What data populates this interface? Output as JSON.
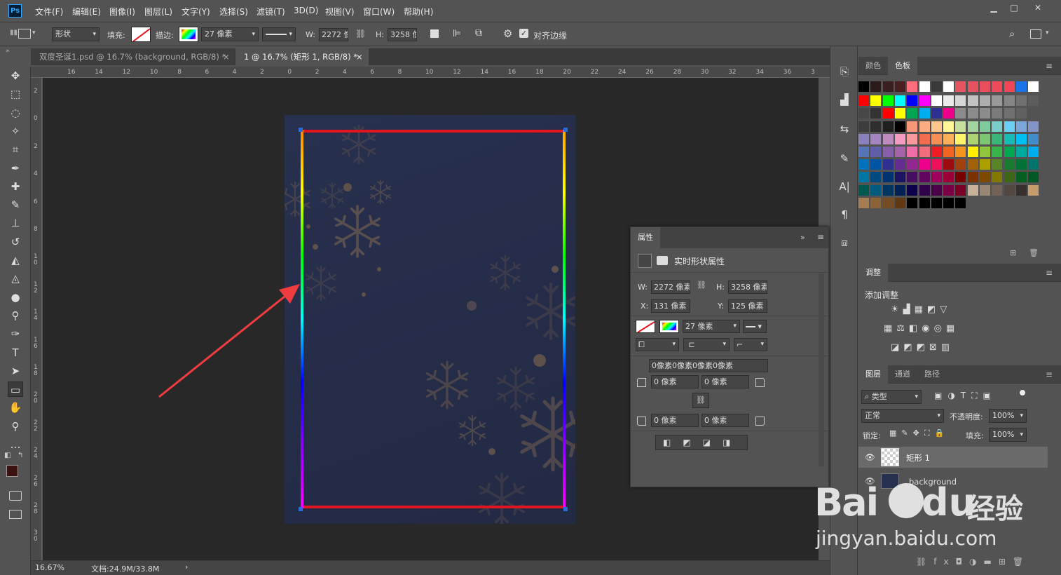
{
  "app": {
    "logo": "Ps"
  },
  "menu": [
    "文件(F)",
    "编辑(E)",
    "图像(I)",
    "图层(L)",
    "文字(Y)",
    "选择(S)",
    "滤镜(T)",
    "3D(D)",
    "视图(V)",
    "窗口(W)",
    "帮助(H)"
  ],
  "window_controls": {
    "minimize": "▁",
    "maximize": "□",
    "close": "✕"
  },
  "options": {
    "mode": "形状",
    "fill_label": "填充:",
    "stroke_label": "描边:",
    "stroke_width": "27 像素",
    "w_label": "W:",
    "w_value": "2272 像",
    "h_label": "H:",
    "h_value": "3258 像",
    "align_edges": "对齐边缘",
    "align_checked": true
  },
  "tabs": [
    {
      "label": "双度圣诞1.psd @ 16.7% (background, RGB/8) *",
      "close": "×",
      "active": false
    },
    {
      "label": "1 @ 16.7% (矩形 1, RGB/8) *",
      "close": "×",
      "active": true
    }
  ],
  "ruler_h": [
    "16",
    "14",
    "12",
    "10",
    "8",
    "6",
    "4",
    "2",
    "0",
    "2",
    "4",
    "6",
    "8",
    "10",
    "12",
    "14",
    "16",
    "18",
    "20",
    "22",
    "24",
    "26",
    "28",
    "30",
    "32",
    "34",
    "36",
    "3"
  ],
  "ruler_v": [
    "2",
    "0",
    "2",
    "4",
    "6",
    "8",
    "1\n0",
    "1\n2",
    "1\n4",
    "1\n6",
    "1\n8",
    "2\n0",
    "2\n2",
    "2\n4",
    "2\n6",
    "2\n8",
    "3\n0"
  ],
  "status": {
    "zoom": "16.67%",
    "doc": "文档:24.9M/33.8M",
    "arrow": "›"
  },
  "tools": [
    "move-icon",
    "marquee-icon",
    "lasso-icon",
    "magic-wand-icon",
    "crop-icon",
    "eyedropper-icon",
    "healing-icon",
    "brush-icon",
    "stamp-icon",
    "history-brush-icon",
    "eraser-icon",
    "bucket-icon",
    "blur-icon",
    "dodge-icon",
    "pen-icon",
    "type-icon",
    "path-select-icon",
    "rectangle-icon",
    "hand-icon",
    "zoom-icon",
    "more-icon"
  ],
  "colors": {
    "foreground": "#3a1212",
    "background": "#ffffff",
    "stroke_gradient": "rainbow",
    "frame": "#e2141e"
  },
  "swatches_panel": {
    "tab_color": "颜色",
    "tab_swatches": "色板"
  },
  "swatch_rows": [
    [
      "#000000",
      "#2b1a1a",
      "#3a1f1f",
      "#4a1f22",
      "#ff6e7a",
      "#ffffff",
      "#3a3a3a",
      "#ffffff",
      "#e65561",
      "#e8515f",
      "#ea4d5c",
      "#ee4a59",
      "#f04655",
      "#1a73e8",
      "#ffffff"
    ],
    [
      "#ff0000",
      "#ffff00",
      "#00ff00",
      "#00ffff",
      "#0000ff",
      "#ff00ff",
      "#ffffff",
      "#ebebeb",
      "#d6d6d6",
      "#c2c2c2",
      "#adadad",
      "#999999",
      "#858585",
      "#707070",
      "#5c5c5c"
    ],
    [
      "#474747",
      "#333333",
      "#ff0000",
      "#ffff00",
      "#00a651",
      "#00aeef",
      "#2e3192",
      "#ec008c",
      "#8c8c8c",
      "#8c8c8c",
      "#8c8c8c",
      "#7a7a7a",
      "#707070",
      "#616161",
      "#525252"
    ],
    [
      "#3d3d3d",
      "#2e2e2e",
      "#1f1f1f",
      "#000000",
      "#f7977a",
      "#fbad82",
      "#fdc68c",
      "#fff799",
      "#c6df9c",
      "#a4d49d",
      "#81ca9d",
      "#7bcdc9",
      "#6ccff7",
      "#7ca6d8",
      "#8293ca"
    ],
    [
      "#8881be",
      "#a286bd",
      "#bc8cbf",
      "#f49bc1",
      "#f5999d",
      "#f26c4f",
      "#f68e55",
      "#fbaf59",
      "#fff467",
      "#acd372",
      "#7dc473",
      "#39b778",
      "#16bcb4",
      "#00bff3",
      "#438ccb"
    ],
    [
      "#5573b7",
      "#5e5fa8",
      "#855fa8",
      "#a763a9",
      "#ef6ea8",
      "#f16d7e",
      "#ee1d24",
      "#f16522",
      "#f7941d",
      "#fff100",
      "#8fc63d",
      "#37b44a",
      "#00a650",
      "#00a99e",
      "#00aeef"
    ],
    [
      "#0072bc",
      "#0054a5",
      "#2f3192",
      "#652c91",
      "#91278f",
      "#ed008c",
      "#ee105a",
      "#9d0a0f",
      "#a1410d",
      "#a36209",
      "#aba000",
      "#588528",
      "#197b30",
      "#007236",
      "#00736a"
    ],
    [
      "#0076a4",
      "#004a80",
      "#003370",
      "#1d1363",
      "#450e61",
      "#62055f",
      "#9e005c",
      "#9d0039",
      "#790000",
      "#7b3000",
      "#7c4900",
      "#827a00",
      "#3e6617",
      "#045f20",
      "#005824"
    ],
    [
      "#005951",
      "#005b7e",
      "#003562",
      "#002056",
      "#0c004b",
      "#30004a",
      "#4b0048",
      "#7a0045",
      "#7a0026",
      "#c7b299",
      "#998675",
      "#736357",
      "#534741",
      "#37302d",
      "#c69c6d"
    ],
    [
      "#a67c52",
      "#8c6239",
      "#754c24",
      "#603913",
      "#000000",
      "#000000",
      "#000000",
      "#000000",
      "#000000",
      "#000000",
      "#000000",
      "#000000",
      "#000000",
      "#000000",
      "#000000"
    ]
  ],
  "adjust_panel": {
    "title": "调整",
    "add": "添加调整"
  },
  "layers_panel": {
    "tabs": [
      "图层",
      "通道",
      "路径"
    ],
    "kind": "类型",
    "blend": "正常",
    "opacity_label": "不透明度:",
    "opacity": "100%",
    "lock_label": "锁定:",
    "fill_label": "填充:",
    "fill": "100%",
    "layers": [
      {
        "name": "矩形 1",
        "selected": true
      },
      {
        "name": "background",
        "selected": false
      }
    ]
  },
  "properties": {
    "title": "属性",
    "subtitle": "实时形状属性",
    "w_label": "W:",
    "w": "2272 像素",
    "h_label": "H:",
    "h": "3258 像素",
    "x_label": "X:",
    "x": "131 像素",
    "y_label": "Y:",
    "y": "125 像素",
    "stroke_width": "27 像素",
    "radius_all": "0像素0像素0像素0像素",
    "r_tl": "0 像素",
    "r_tr": "0 像素",
    "r_bl": "0 像素",
    "r_br": "0 像素"
  },
  "watermark": {
    "brand": "Bai",
    "brand2": "du",
    "cn": "经验",
    "url": "jingyan.baidu.com"
  }
}
